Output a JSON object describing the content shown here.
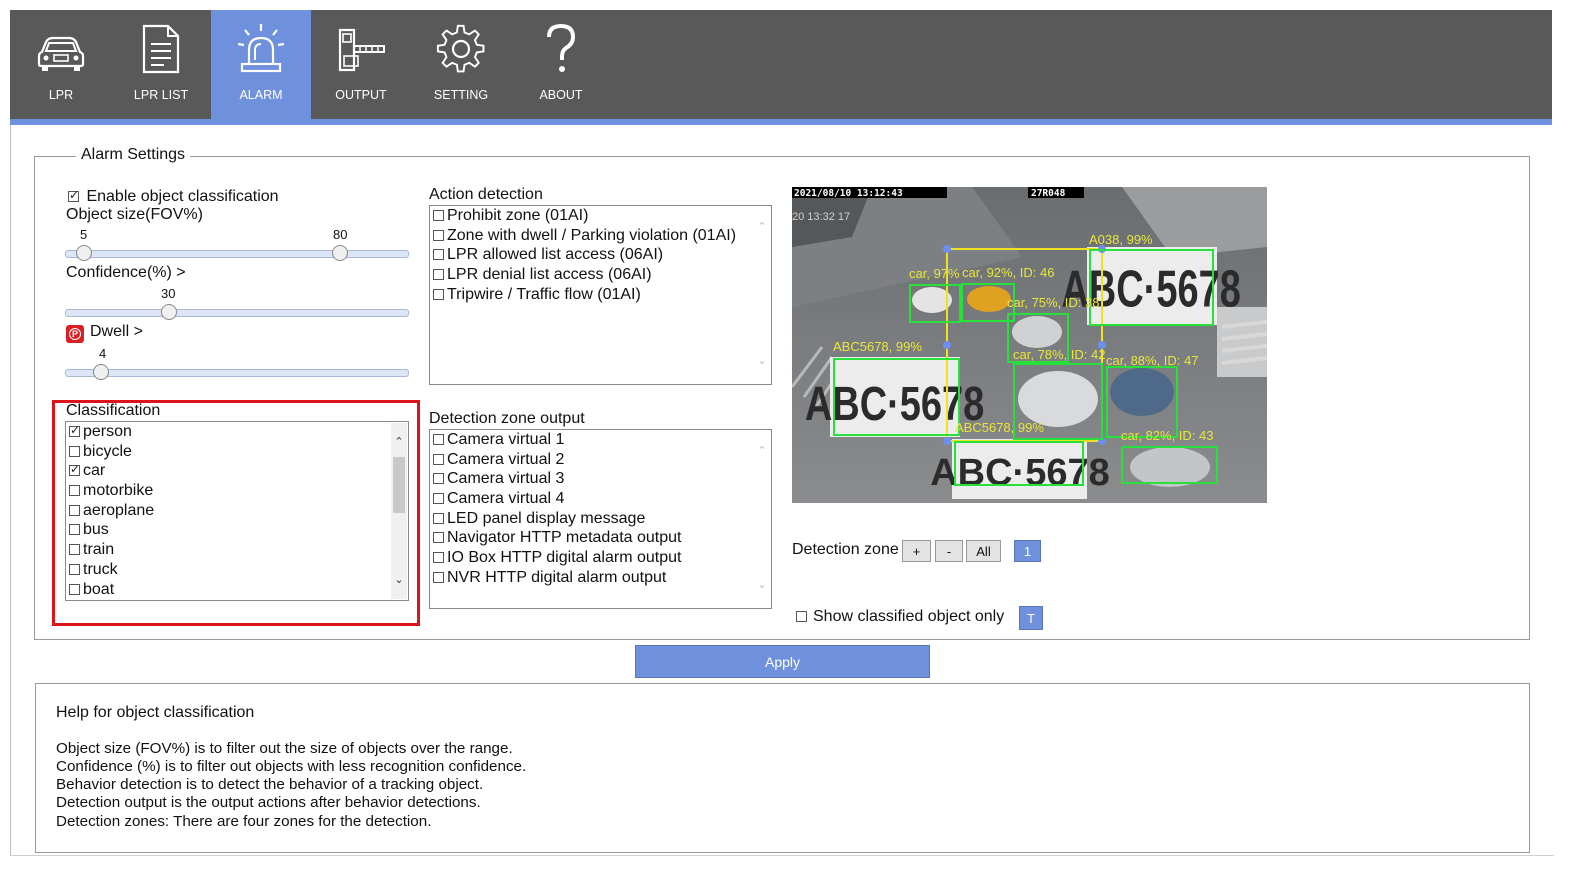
{
  "nav": {
    "tabs": [
      {
        "label": "LPR",
        "icon": "car-icon",
        "active": false
      },
      {
        "label": "LPR LIST",
        "icon": "document-icon",
        "active": false
      },
      {
        "label": "ALARM",
        "icon": "alarm-siren-icon",
        "active": true
      },
      {
        "label": "OUTPUT",
        "icon": "barrier-gate-icon",
        "active": false
      },
      {
        "label": "SETTING",
        "icon": "gear-icon",
        "active": false
      },
      {
        "label": "ABOUT",
        "icon": "question-icon",
        "active": false
      }
    ],
    "accent_color": "#6f90dd",
    "bar_color": "#595959"
  },
  "alarm_settings": {
    "legend": "Alarm Settings",
    "enable_classification": {
      "label": "Enable object classification",
      "checked": true
    },
    "object_size": {
      "label": "Object size(FOV%)",
      "min_value": "5",
      "max_value": "80"
    },
    "confidence": {
      "label": "Confidence(%) >",
      "value": "30"
    },
    "dwell": {
      "label": "Dwell >",
      "value": "4",
      "icon": "dwell-p-icon"
    },
    "classification": {
      "label": "Classification",
      "items": [
        {
          "label": "person",
          "checked": true
        },
        {
          "label": "bicycle",
          "checked": false
        },
        {
          "label": "car",
          "checked": true
        },
        {
          "label": "motorbike",
          "checked": false
        },
        {
          "label": "aeroplane",
          "checked": false
        },
        {
          "label": "bus",
          "checked": false
        },
        {
          "label": "train",
          "checked": false
        },
        {
          "label": "truck",
          "checked": false
        },
        {
          "label": "boat",
          "checked": false
        }
      ]
    },
    "action_detection": {
      "label": "Action detection",
      "items": [
        {
          "label": "Prohibit zone (01AI)",
          "checked": false
        },
        {
          "label": "Zone with dwell / Parking violation (01AI)",
          "checked": false
        },
        {
          "label": "LPR allowed list access (06AI)",
          "checked": false
        },
        {
          "label": "LPR denial list access (06AI)",
          "checked": false
        },
        {
          "label": "Tripwire / Traffic flow (01AI)",
          "checked": false
        }
      ]
    },
    "detection_zone_output": {
      "label": "Detection zone output",
      "items": [
        {
          "label": "Camera virtual 1",
          "checked": false
        },
        {
          "label": "Camera virtual 2",
          "checked": false
        },
        {
          "label": "Camera virtual 3",
          "checked": false
        },
        {
          "label": "Camera virtual 4",
          "checked": false
        },
        {
          "label": "LED panel display message",
          "checked": false
        },
        {
          "label": "Navigator HTTP metadata output",
          "checked": false
        },
        {
          "label": "IO Box HTTP digital alarm output",
          "checked": false
        },
        {
          "label": "NVR HTTP digital alarm output",
          "checked": false
        }
      ]
    },
    "camera": {
      "timestamp": "2021/08/10 13:12:43",
      "channel": "27R048",
      "overlay_time": "20 13:32 17",
      "detections": [
        {
          "label": "A038, 99%"
        },
        {
          "label": "car, 97%"
        },
        {
          "label": "car, 92%, ID: 46"
        },
        {
          "label": "car, 75%, ID: 38"
        },
        {
          "label": "ABC5678, 99%"
        },
        {
          "label": "car, 78%, ID: 42"
        },
        {
          "label": "car, 88%, ID: 47"
        },
        {
          "label": "ABC5678, 99%"
        },
        {
          "label": "car, 82%, ID: 43"
        }
      ],
      "plates": [
        "ABC·5678",
        "ABC·5678",
        "ABC·5678"
      ]
    },
    "detection_zone": {
      "label": "Detection zone",
      "plus": "+",
      "minus": "-",
      "all": "All",
      "selected": "1"
    },
    "show_classified": {
      "label": "Show classified object only",
      "checked": false,
      "toggle": "T"
    }
  },
  "apply_label": "Apply",
  "help": {
    "title": "Help for object classification",
    "lines": [
      "Object size (FOV%) is to filter out the size of objects over the range.",
      "Confidence (%) is to filter out objects with less recognition confidence.",
      "Behavior detection is to detect the behavior of a tracking object.",
      "Detection output is the output actions after behavior detections.",
      "Detection zones: There are four zones for the detection."
    ]
  }
}
